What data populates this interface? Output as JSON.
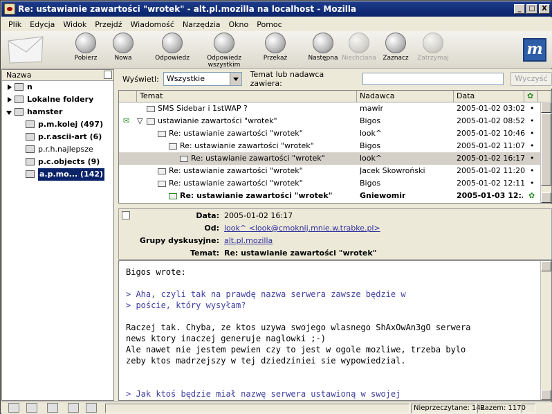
{
  "window": {
    "title": "Re: ustawianie zawartości \"wrotek\" - alt.pl.mozilla na localhost - Mozilla",
    "buttons": {
      "minimize": "_",
      "maximize": "□",
      "close": "X"
    }
  },
  "menu": [
    "Plik",
    "Edycja",
    "Widok",
    "Przejdź",
    "Wiadomość",
    "Narzędzia",
    "Okno",
    "Pomoc"
  ],
  "toolbar": {
    "buttons": [
      {
        "label": "Pobierz",
        "icon": "get-messages-icon",
        "enabled": true
      },
      {
        "label": "Nowa",
        "icon": "compose-icon",
        "enabled": true
      },
      {
        "label": "Odpowiedz",
        "icon": "reply-icon",
        "enabled": true
      },
      {
        "label": "Odpowiedz wszystkim",
        "icon": "reply-all-icon",
        "enabled": true
      },
      {
        "label": "Przekaż",
        "icon": "forward-icon",
        "enabled": true
      },
      {
        "label": "Następna",
        "icon": "next-icon",
        "enabled": true
      },
      {
        "label": "Niechciana",
        "icon": "junk-icon",
        "enabled": false
      },
      {
        "label": "Zaznacz",
        "icon": "mark-icon",
        "enabled": true
      },
      {
        "label": "Zatrzymaj",
        "icon": "stop-icon",
        "enabled": false
      }
    ],
    "brand": "m"
  },
  "folder_pane": {
    "header": "Nazwa",
    "items": [
      {
        "label": "n",
        "level": 0,
        "expanded": false,
        "selected": false
      },
      {
        "label": "Lokalne foldery",
        "level": 0,
        "expanded": false,
        "selected": false
      },
      {
        "label": "hamster",
        "level": 0,
        "expanded": true,
        "selected": false
      },
      {
        "label": "p.m.kolej (497)",
        "level": 1,
        "expanded": false,
        "selected": false
      },
      {
        "label": "p.r.ascii-art (6)",
        "level": 1,
        "expanded": false,
        "selected": false
      },
      {
        "label": "p.r.h.najlepsze",
        "level": 1,
        "expanded": false,
        "selected": false
      },
      {
        "label": "p.c.objects (9)",
        "level": 1,
        "expanded": false,
        "selected": false
      },
      {
        "label": "a.p.mo... (142)",
        "level": 1,
        "expanded": false,
        "selected": true
      }
    ]
  },
  "filter": {
    "show_label": "Wyświetl:",
    "show_value": "Wszystkie",
    "search_label": "Temat lub nadawca zawiera:",
    "search_value": "",
    "clear_button": "Wyczyść"
  },
  "thread_pane": {
    "columns": [
      "Temat",
      "Nadawca",
      "Data"
    ],
    "rows": [
      {
        "subject": "SMS Sidebar i 1stWAP ?",
        "sender": "mawir",
        "date": "2005-01-02 03:02",
        "indent": 0,
        "selected": false,
        "unread": false
      },
      {
        "subject": "ustawianie zawartości \"wrotek\"",
        "sender": "Bigos",
        "date": "2005-01-02 08:52",
        "indent": 0,
        "selected": false,
        "unread": false
      },
      {
        "subject": "Re: ustawianie zawartości \"wrotek\"",
        "sender": "look^",
        "date": "2005-01-02 10:46",
        "indent": 1,
        "selected": false,
        "unread": false
      },
      {
        "subject": "Re: ustawianie zawartości \"wrotek\"",
        "sender": "Bigos",
        "date": "2005-01-02 11:07",
        "indent": 2,
        "selected": false,
        "unread": false
      },
      {
        "subject": "Re: ustawianie zawartości \"wrotek\"",
        "sender": "look^",
        "date": "2005-01-02 16:17",
        "indent": 3,
        "selected": true,
        "unread": false
      },
      {
        "subject": "Re: ustawianie zawartości \"wrotek\"",
        "sender": "Jacek Skowroński",
        "date": "2005-01-02 11:20",
        "indent": 1,
        "selected": false,
        "unread": false
      },
      {
        "subject": "Re: ustawianie zawartości \"wrotek\"",
        "sender": "Bigos",
        "date": "2005-01-02 12:11",
        "indent": 1,
        "selected": false,
        "unread": false
      },
      {
        "subject": "Re: ustawianie zawartości \"wrotek\"",
        "sender": "Gniewomir",
        "date": "2005-01-03 12:...",
        "indent": 2,
        "selected": false,
        "unread": true
      }
    ]
  },
  "message": {
    "date_label": "Data:",
    "date": "2005-01-02 16:17",
    "from_label": "Od:",
    "from": "look^ <look@cmoknij.mnie.w.trabke.pl>",
    "groups_label": "Grupy dyskusyjne:",
    "groups": "alt.pl.mozilla",
    "subject_label": "Temat:",
    "subject": "Re: ustawianie zawartości \"wrotek\"",
    "body_lines": [
      {
        "text": "Bigos wrote:",
        "quote": false
      },
      {
        "text": "",
        "quote": false
      },
      {
        "text": "> Aha, czyli tak na prawdę nazwa serwera zawsze będzie w",
        "quote": true
      },
      {
        "text": "> poście, który wysyłam?",
        "quote": true
      },
      {
        "text": "",
        "quote": false
      },
      {
        "text": "Raczej tak. Chyba, ze ktos uzywa swojego wlasnego ShAxOwAn3gO serwera",
        "quote": false
      },
      {
        "text": "news ktory inaczej generuje naglowki ;-)",
        "quote": false
      },
      {
        "text": "Ale nawet nie jestem pewien czy to jest w ogole mozliwe, trzeba bylo",
        "quote": false
      },
      {
        "text": "zeby ktos madrzejszy w tej dziedziniei sie wypowiedzial.",
        "quote": false
      },
      {
        "text": "",
        "quote": false
      },
      {
        "text": "",
        "quote": false
      },
      {
        "text": "> Jak ktoś będzie miał nazwę serwera ustawioną w swojej",
        "quote": true
      }
    ]
  },
  "status": {
    "unread": "Nieprzeczytane: 142",
    "total": "Razem: 1170"
  }
}
